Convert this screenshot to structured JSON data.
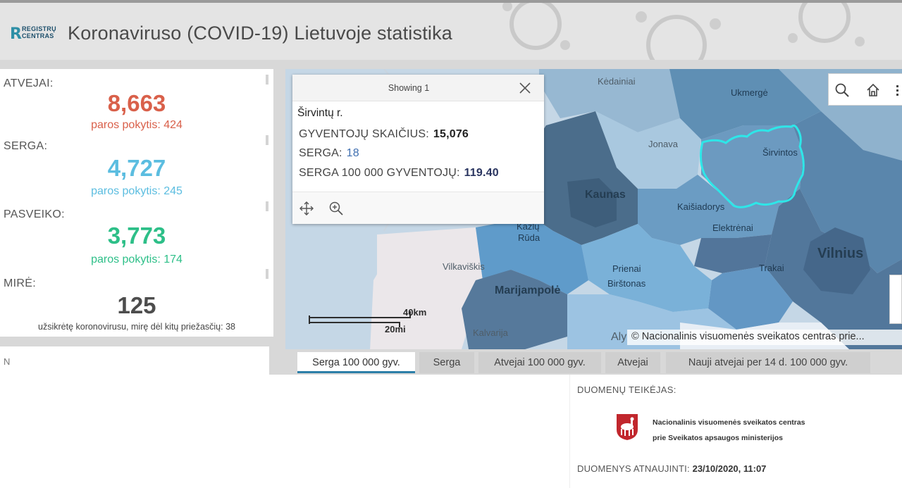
{
  "header": {
    "logo_line1": "REGISTRŲ",
    "logo_line2": "CENTRAS",
    "title": "Koronaviruso (COVID-19) Lietuvoje statistika"
  },
  "stats": {
    "cases": {
      "label": "ATVEJAI:",
      "value": "8,663",
      "change": "paros pokytis: 424"
    },
    "sick": {
      "label": "SERGA:",
      "value": "4,727",
      "change": "paros pokytis: 245"
    },
    "recovered": {
      "label": "PASVEIKO:",
      "value": "3,773",
      "change": "paros pokytis: 174"
    },
    "died": {
      "label": "MIRĖ:",
      "value": "125",
      "note": "užsikrėtę koronovirusu, mirę dėl kitų priežasčių: 38"
    },
    "second_panel_text": "N"
  },
  "map": {
    "labels": {
      "kedainiai": "Kėdainiai",
      "ukmerge": "Ukmergė",
      "jonava": "Jonava",
      "sirvintos": "Širvintos",
      "kaunas": "Kaunas",
      "kaisiadorys": "Kaišiadorys",
      "elektrenai": "Elektrėnai",
      "vilnius": "Vilnius",
      "kazlu_ruda_1": "Kazlų",
      "kazlu_ruda_2": "Rūda",
      "vilkaviskis": "Vilkaviškis",
      "prienai": "Prienai",
      "birstonas": "Birštonas",
      "trakai": "Trakai",
      "marijampole": "Marijampolė",
      "kalvarija": "Kalvarija",
      "alytus": "Aly"
    },
    "scale_km": "40km",
    "scale_mi": "20mi",
    "attribution": "© Nacionalinis visuomenės sveikatos centras prie..."
  },
  "popup": {
    "showing": "Showing 1",
    "name": "Širvintų r.",
    "rows": [
      {
        "label": "GYVENTOJŲ SKAIČIUS:",
        "value": "15,076"
      },
      {
        "label": "SERGA:",
        "value": "18"
      },
      {
        "label": "SERGA 100 000 GYVENTOJŲ:",
        "value": "119.40"
      }
    ]
  },
  "tabs": [
    "Serga 100 000 gyv.",
    "Serga",
    "Atvejai 100 000 gyv.",
    "Atvejai",
    "Nauji atvejai per 14 d. 100 000 gyv."
  ],
  "provider": {
    "label": "DUOMENŲ TEIKĖJAS:",
    "line1": "Nacionalinis visuomenės sveikatos centras",
    "line2": "prie Sveikatos apsaugos ministerijos",
    "updated_label": "DUOMENYS ATNAUJINTI:",
    "updated_value": "23/10/2020, 11:07"
  },
  "colors": {
    "cases": "#d9604a",
    "sick": "#5bbde0",
    "recovered": "#2dbf88",
    "died": "#4d4d4d",
    "highlight": "#2ee6e8"
  }
}
